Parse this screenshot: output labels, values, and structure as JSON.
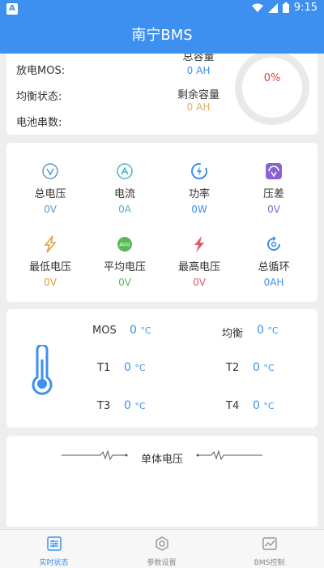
{
  "status": {
    "app_badge": "A",
    "time": "9:15"
  },
  "appbar": {
    "title": "南宁BMS"
  },
  "summary": {
    "discharge_mos_label": "放电MOS:",
    "balance_label": "均衡状态:",
    "cell_count_label": "电池串数:",
    "total_capacity_label": "总容量",
    "total_capacity_value": "0 AH",
    "remaining_capacity_label": "剩余容量",
    "remaining_capacity_value": "0 AH",
    "soc_percent": "0%"
  },
  "metrics": [
    {
      "icon": "voltage-icon",
      "name": "总电压",
      "value": "0V",
      "color": "#5b9bd5"
    },
    {
      "icon": "current-icon",
      "name": "电流",
      "value": "0A",
      "color": "#4fb3c9"
    },
    {
      "icon": "power-icon",
      "name": "功率",
      "value": "0W",
      "color": "#3d8ff0"
    },
    {
      "icon": "voltage-diff-icon",
      "name": "压差",
      "value": "0V",
      "color": "#8a63d2"
    },
    {
      "icon": "min-voltage-icon",
      "name": "最低电压",
      "value": "0V",
      "color": "#e0a030"
    },
    {
      "icon": "avg-voltage-icon",
      "name": "平均电压",
      "value": "0V",
      "color": "#58b858"
    },
    {
      "icon": "max-voltage-icon",
      "name": "最高电压",
      "value": "0V",
      "color": "#e05b6b"
    },
    {
      "icon": "cycle-icon",
      "name": "总循环",
      "value": "0AH",
      "color": "#3d8ff0"
    }
  ],
  "temps": {
    "mos_label": "MOS",
    "mos_value": "0",
    "balance_label": "均衡",
    "balance_value": "0",
    "t1_label": "T1",
    "t1_value": "0",
    "t2_label": "T2",
    "t2_value": "0",
    "t3_label": "T3",
    "t3_value": "0",
    "t4_label": "T4",
    "t4_value": "0",
    "unit": "°C"
  },
  "cells": {
    "title": "单体电压"
  },
  "tabs": [
    {
      "label": "实时状态",
      "icon": "realtime-icon",
      "active": true
    },
    {
      "label": "参数设置",
      "icon": "settings-icon",
      "active": false
    },
    {
      "label": "BMS控制",
      "icon": "chart-icon",
      "active": false
    }
  ],
  "colors": {
    "primary": "#3d8ff0",
    "soc": "#e04040",
    "remaining": "#e0b060"
  }
}
